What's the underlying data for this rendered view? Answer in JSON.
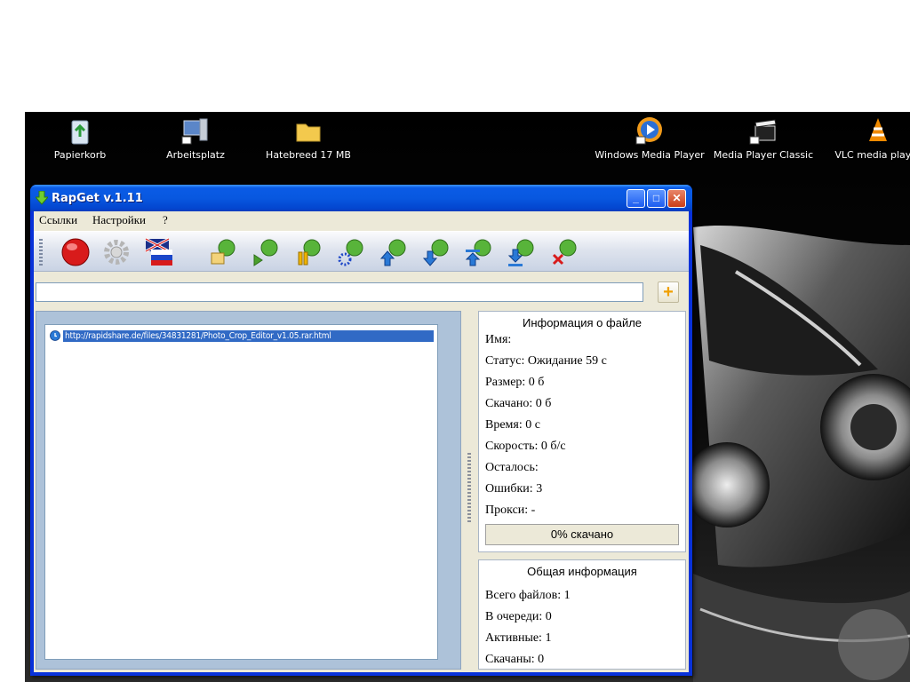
{
  "desktop": {
    "icons": [
      {
        "label": "Papierkorb",
        "icon": "recycle-bin-icon"
      },
      {
        "label": "Arbeitsplatz",
        "icon": "computer-icon"
      },
      {
        "label": "Hatebreed 17 MB",
        "icon": "folder-icon"
      },
      {
        "label": "Windows Media Player",
        "icon": "media-player-icon"
      },
      {
        "label": "Media Player Classic",
        "icon": "clapperboard-icon"
      },
      {
        "label": "VLC media player",
        "icon": "vlc-cone-icon"
      }
    ]
  },
  "window": {
    "title": "RapGet v.1.11",
    "controls": {
      "minimize": "_",
      "maximize": "□",
      "close": "✕"
    }
  },
  "menu": {
    "links": "Ссылки",
    "settings": "Настройки",
    "help": "?"
  },
  "toolbar": {
    "tools": [
      "stop-icon",
      "settings-gear-icon",
      "language-flag-icon",
      "open-folder-icon",
      "start-icon",
      "pause-icon",
      "options-icon",
      "move-up-icon",
      "move-down-icon",
      "move-top-icon",
      "move-bottom-icon",
      "delete-icon"
    ]
  },
  "url_bar": {
    "value": "",
    "add_label": "+"
  },
  "downloads": {
    "items": [
      {
        "url": "http://rapidshare.de/files/34831281/Photo_Crop_Editor_v1.05.rar.html"
      }
    ]
  },
  "file_info": {
    "title": "Информация о файле",
    "name": "Имя:",
    "status": "Статус: Ожидание 59 с",
    "size": "Размер: 0 б",
    "downloaded": "Скачано: 0 б",
    "time": "Время: 0 с",
    "speed": "Скорость: 0 б/с",
    "remaining": "Осталось:",
    "errors": "Ошибки: 3",
    "proxy": "Прокси: -",
    "progress_label": "0% скачано",
    "progress_percent": 0
  },
  "general_info": {
    "title": "Общая информация",
    "total": "Всего файлов: 1",
    "queued": "В очереди: 0",
    "active": "Активные: 1",
    "completed": "Скачаны: 0"
  },
  "colors": {
    "selection": "#316ac5",
    "titlebar": "#0858e0",
    "panel": "#adc2d9"
  }
}
